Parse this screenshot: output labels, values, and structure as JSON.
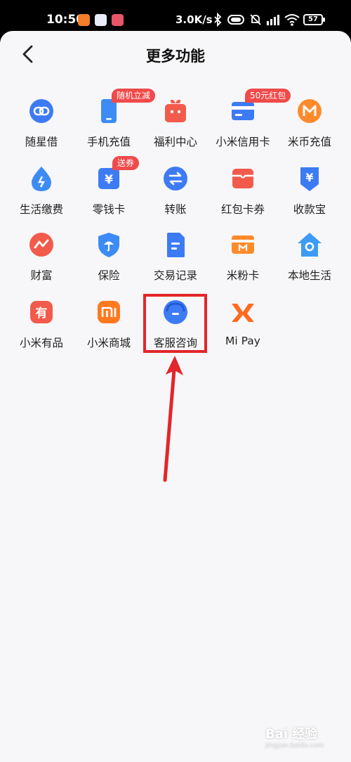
{
  "status_bar": {
    "time": "10:50",
    "speed": "3.0K/s",
    "battery": "57",
    "app_icons": [
      {
        "name": "mi-app-icon",
        "color": "#f57e2a"
      },
      {
        "name": "calendar-app-icon",
        "color": "#e9eef6"
      },
      {
        "name": "douyin-app-icon",
        "color": "#e8556b"
      }
    ]
  },
  "header": {
    "title": "更多功能"
  },
  "badges": {
    "phone_recharge": "随机立减",
    "xiaomi_card": "50元红包",
    "change_card": "送券"
  },
  "features": [
    {
      "name": "suixingjie",
      "label": "随星借",
      "icon": "link-icon",
      "color": "#3d7bf5"
    },
    {
      "name": "phone-recharge",
      "label": "手机充值",
      "icon": "phone-icon",
      "color": "#3d8bf5"
    },
    {
      "name": "welfare-center",
      "label": "福利中心",
      "icon": "gift-icon",
      "color": "#f25b4b"
    },
    {
      "name": "xiaomi-credit-card",
      "label": "小米信用卡",
      "icon": "card-icon",
      "color": "#3d7bf5"
    },
    {
      "name": "mi-coin-recharge",
      "label": "米币充值",
      "icon": "coin-icon",
      "color": "#ff8a2b"
    },
    {
      "name": "utility-payment",
      "label": "生活缴费",
      "icon": "drop-icon",
      "color": "#3d8bf5"
    },
    {
      "name": "change-card",
      "label": "零钱卡",
      "icon": "wallet-icon",
      "color": "#3d7bf5"
    },
    {
      "name": "transfer",
      "label": "转账",
      "icon": "transfer-icon",
      "color": "#3d7bf5"
    },
    {
      "name": "red-packet-voucher",
      "label": "红包卡券",
      "icon": "voucher-icon",
      "color": "#f25b4b"
    },
    {
      "name": "payment-receipt",
      "label": "收款宝",
      "icon": "receive-icon",
      "color": "#3d7bf5"
    },
    {
      "name": "wealth",
      "label": "财富",
      "icon": "wealth-icon",
      "color": "#f25b4b"
    },
    {
      "name": "insurance",
      "label": "保险",
      "icon": "umbrella-shield-icon",
      "color": "#3d8bf5"
    },
    {
      "name": "transaction-records",
      "label": "交易记录",
      "icon": "document-icon",
      "color": "#3d7bf5"
    },
    {
      "name": "mi-fan-card",
      "label": "米粉卡",
      "icon": "mi-card-icon",
      "color": "#ff8a2b"
    },
    {
      "name": "local-life",
      "label": "本地生活",
      "icon": "house-location-icon",
      "color": "#3d9bf5"
    },
    {
      "name": "xiaomi-youpin",
      "label": "小米有品",
      "icon": "youpin-icon",
      "color": "#f25b4b"
    },
    {
      "name": "xiaomi-mall",
      "label": "小米商城",
      "icon": "mi-logo-icon",
      "color": "#ff7a1f"
    },
    {
      "name": "customer-service",
      "label": "客服咨询",
      "icon": "customer-service-icon",
      "color": "#3d7bf5"
    },
    {
      "name": "mi-pay",
      "label": "Mi Pay",
      "icon": "mi-pay-logo-icon",
      "color": "#ff6a1f"
    }
  ],
  "annotation": {
    "color": "#e3262a"
  },
  "watermark": {
    "text": "Bai 经验",
    "sub": "jingyan.baidu.com"
  }
}
